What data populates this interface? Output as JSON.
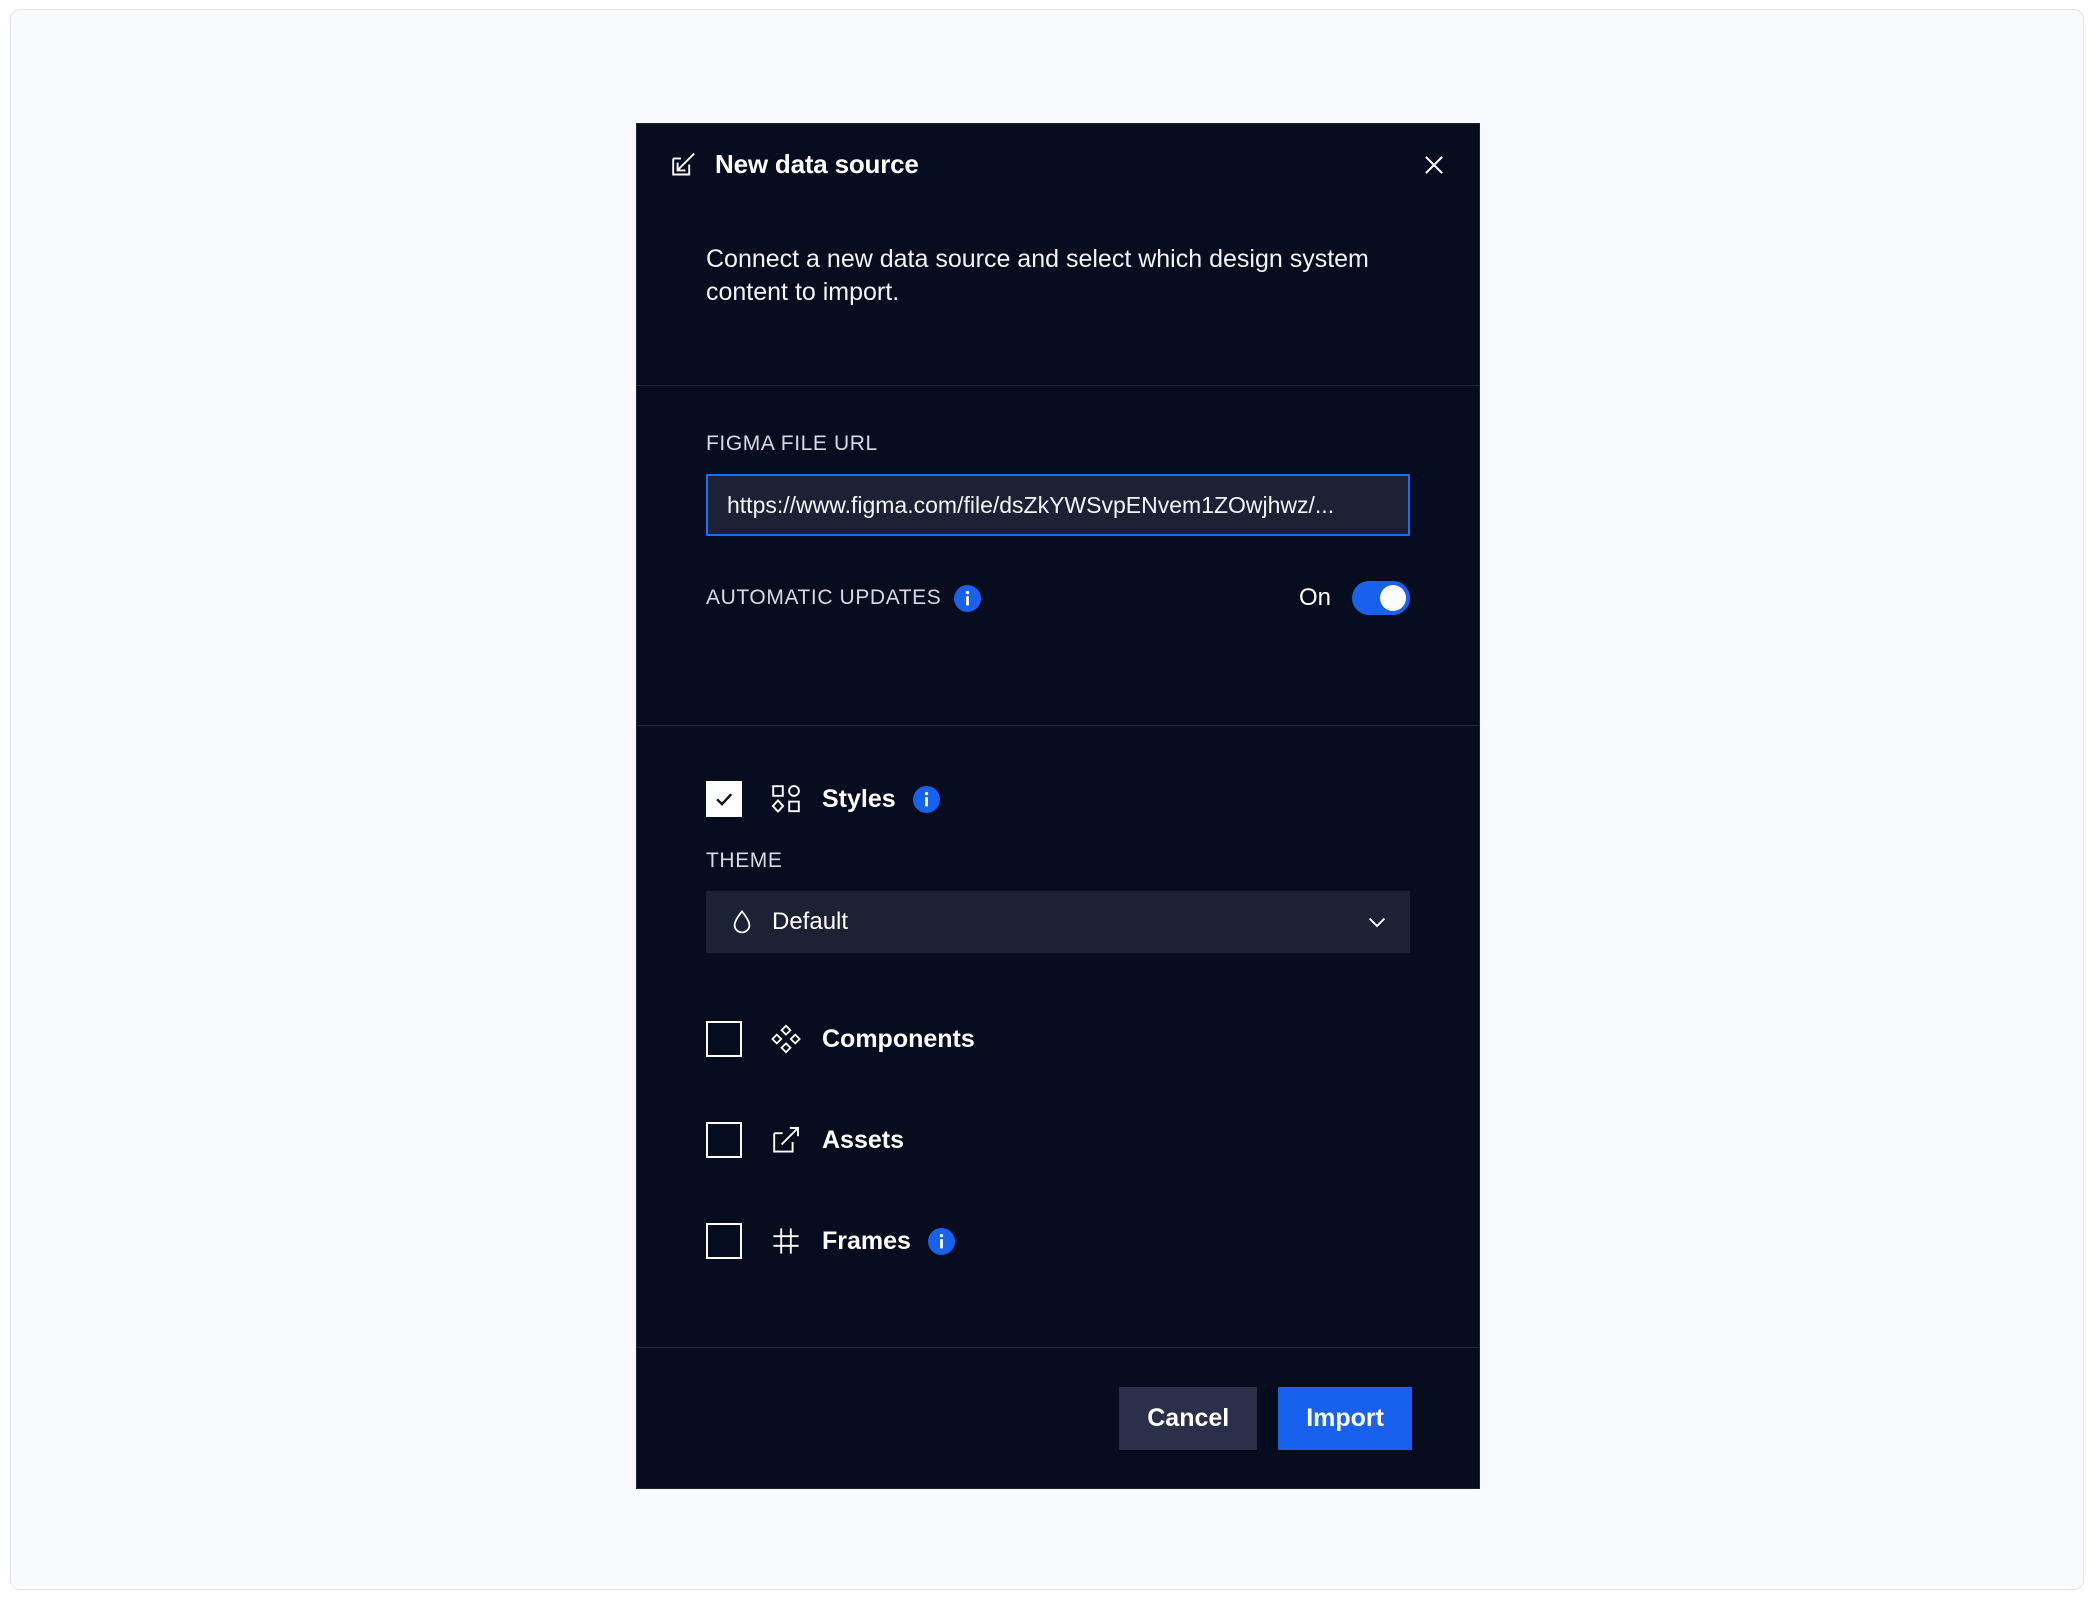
{
  "modal": {
    "title": "New data source",
    "header_icon": "import-arrow-box-icon",
    "close_icon": "close-icon",
    "intro": "Connect a new data source and select which design system content to import.",
    "url_field": {
      "label": "FIGMA FILE URL",
      "value": "https://www.figma.com/file/dsZkYWSvpENvem1ZOwjhwz/...",
      "placeholder": "https://www.figma.com/file/..."
    },
    "automatic_updates": {
      "label": "AUTOMATIC UPDATES",
      "info_icon": "info-icon",
      "state_label": "On",
      "enabled": true
    },
    "options": [
      {
        "id": "styles",
        "label": "Styles",
        "icon": "shapes-grid-icon",
        "checked": true,
        "has_info": true
      },
      {
        "id": "components",
        "label": "Components",
        "icon": "diamond-cluster-icon",
        "checked": false,
        "has_info": false
      },
      {
        "id": "assets",
        "label": "Assets",
        "icon": "external-link-icon",
        "checked": false,
        "has_info": false
      },
      {
        "id": "frames",
        "label": "Frames",
        "icon": "frame-grid-icon",
        "checked": false,
        "has_info": true
      }
    ],
    "theme": {
      "label": "THEME",
      "icon": "droplet-icon",
      "value": "Default",
      "chevron_icon": "chevron-down-icon"
    },
    "footer": {
      "cancel_label": "Cancel",
      "import_label": "Import"
    }
  },
  "colors": {
    "page_background": "#f9fafd",
    "modal_background": "#070d1e",
    "accent_blue": "#1761ed",
    "input_background": "#1c2133",
    "input_border_focus": "#1e6bf5",
    "divider": "#242b40",
    "cancel_button": "#2b3048",
    "text_primary": "#ffffff",
    "text_muted": "#d6dae4"
  }
}
